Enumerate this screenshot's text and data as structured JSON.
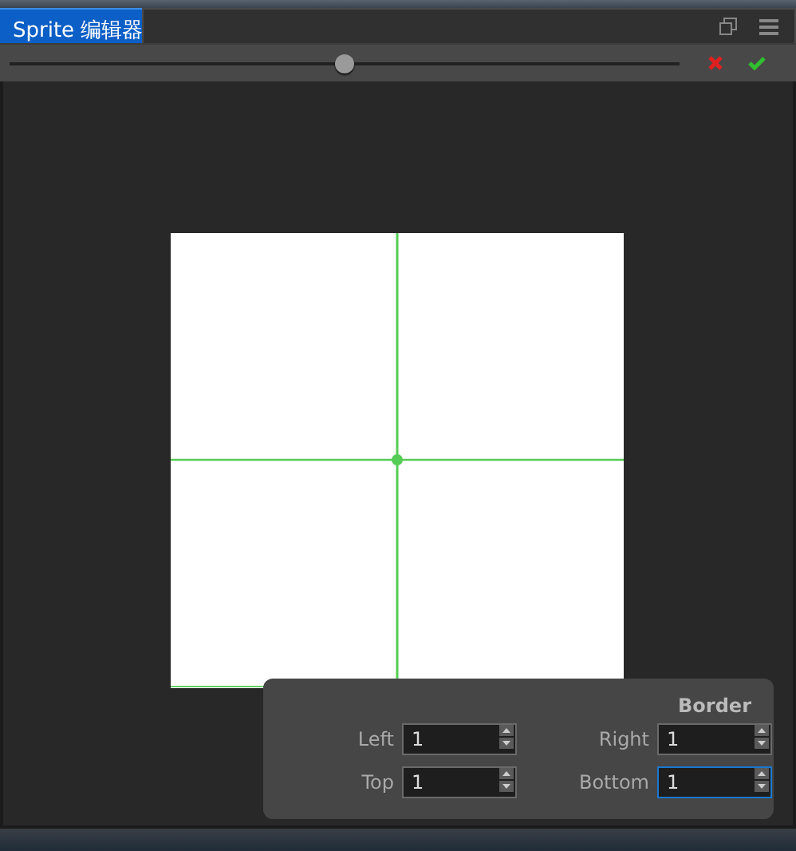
{
  "tab": {
    "label": "Sprite 编辑器",
    "selected": true
  },
  "zoom_slider": {
    "level": 0.5
  },
  "border_panel": {
    "title": "Border",
    "fields": [
      {
        "label": "Left",
        "value": "1",
        "focused": false
      },
      {
        "label": "Right",
        "value": "1",
        "focused": false
      },
      {
        "label": "Top",
        "value": "1",
        "focused": false
      },
      {
        "label": "Bottom",
        "value": "1",
        "focused": true
      }
    ]
  }
}
